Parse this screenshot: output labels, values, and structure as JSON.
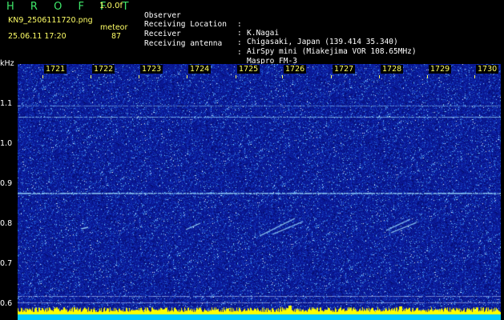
{
  "header": {
    "app_title": "H R O F F T",
    "version": "1.0.0f",
    "filename": "KN9_2506111720.png",
    "type_label": "meteor",
    "datetime": "25.06.11 17:20",
    "count": "87"
  },
  "metadata": [
    {
      "label": "Observer",
      "value": "K.Nagai"
    },
    {
      "label": "Receiving Location",
      "value": "Chigasaki, Japan (139.414 35.340)"
    },
    {
      "label": "Receiver",
      "value": "AirSpy mini (Miakejima VOR 108.65MHz)"
    },
    {
      "label": "Receiving antenna",
      "value": "Maspro FM-3"
    }
  ],
  "spectrogram": {
    "y_unit": "kHz",
    "y_ticks": [
      "1.1",
      "1.0",
      "0.9",
      "0.8",
      "0.7",
      "0.6"
    ],
    "time_ticks": [
      "1721",
      "1722",
      "1723",
      "1724",
      "1725",
      "1726",
      "1727",
      "1728",
      "1729",
      "1730"
    ]
  },
  "colors": {
    "background": "#000000",
    "title_green": "#3fe86a",
    "text_white": "#ffffff",
    "text_yellow": "#ffff66",
    "spectro_bg": "#0a1fa8",
    "signal_cyan": "#9fe0ff",
    "strip_yellow": "#ffff00",
    "strip_cyan": "#00ccff"
  }
}
